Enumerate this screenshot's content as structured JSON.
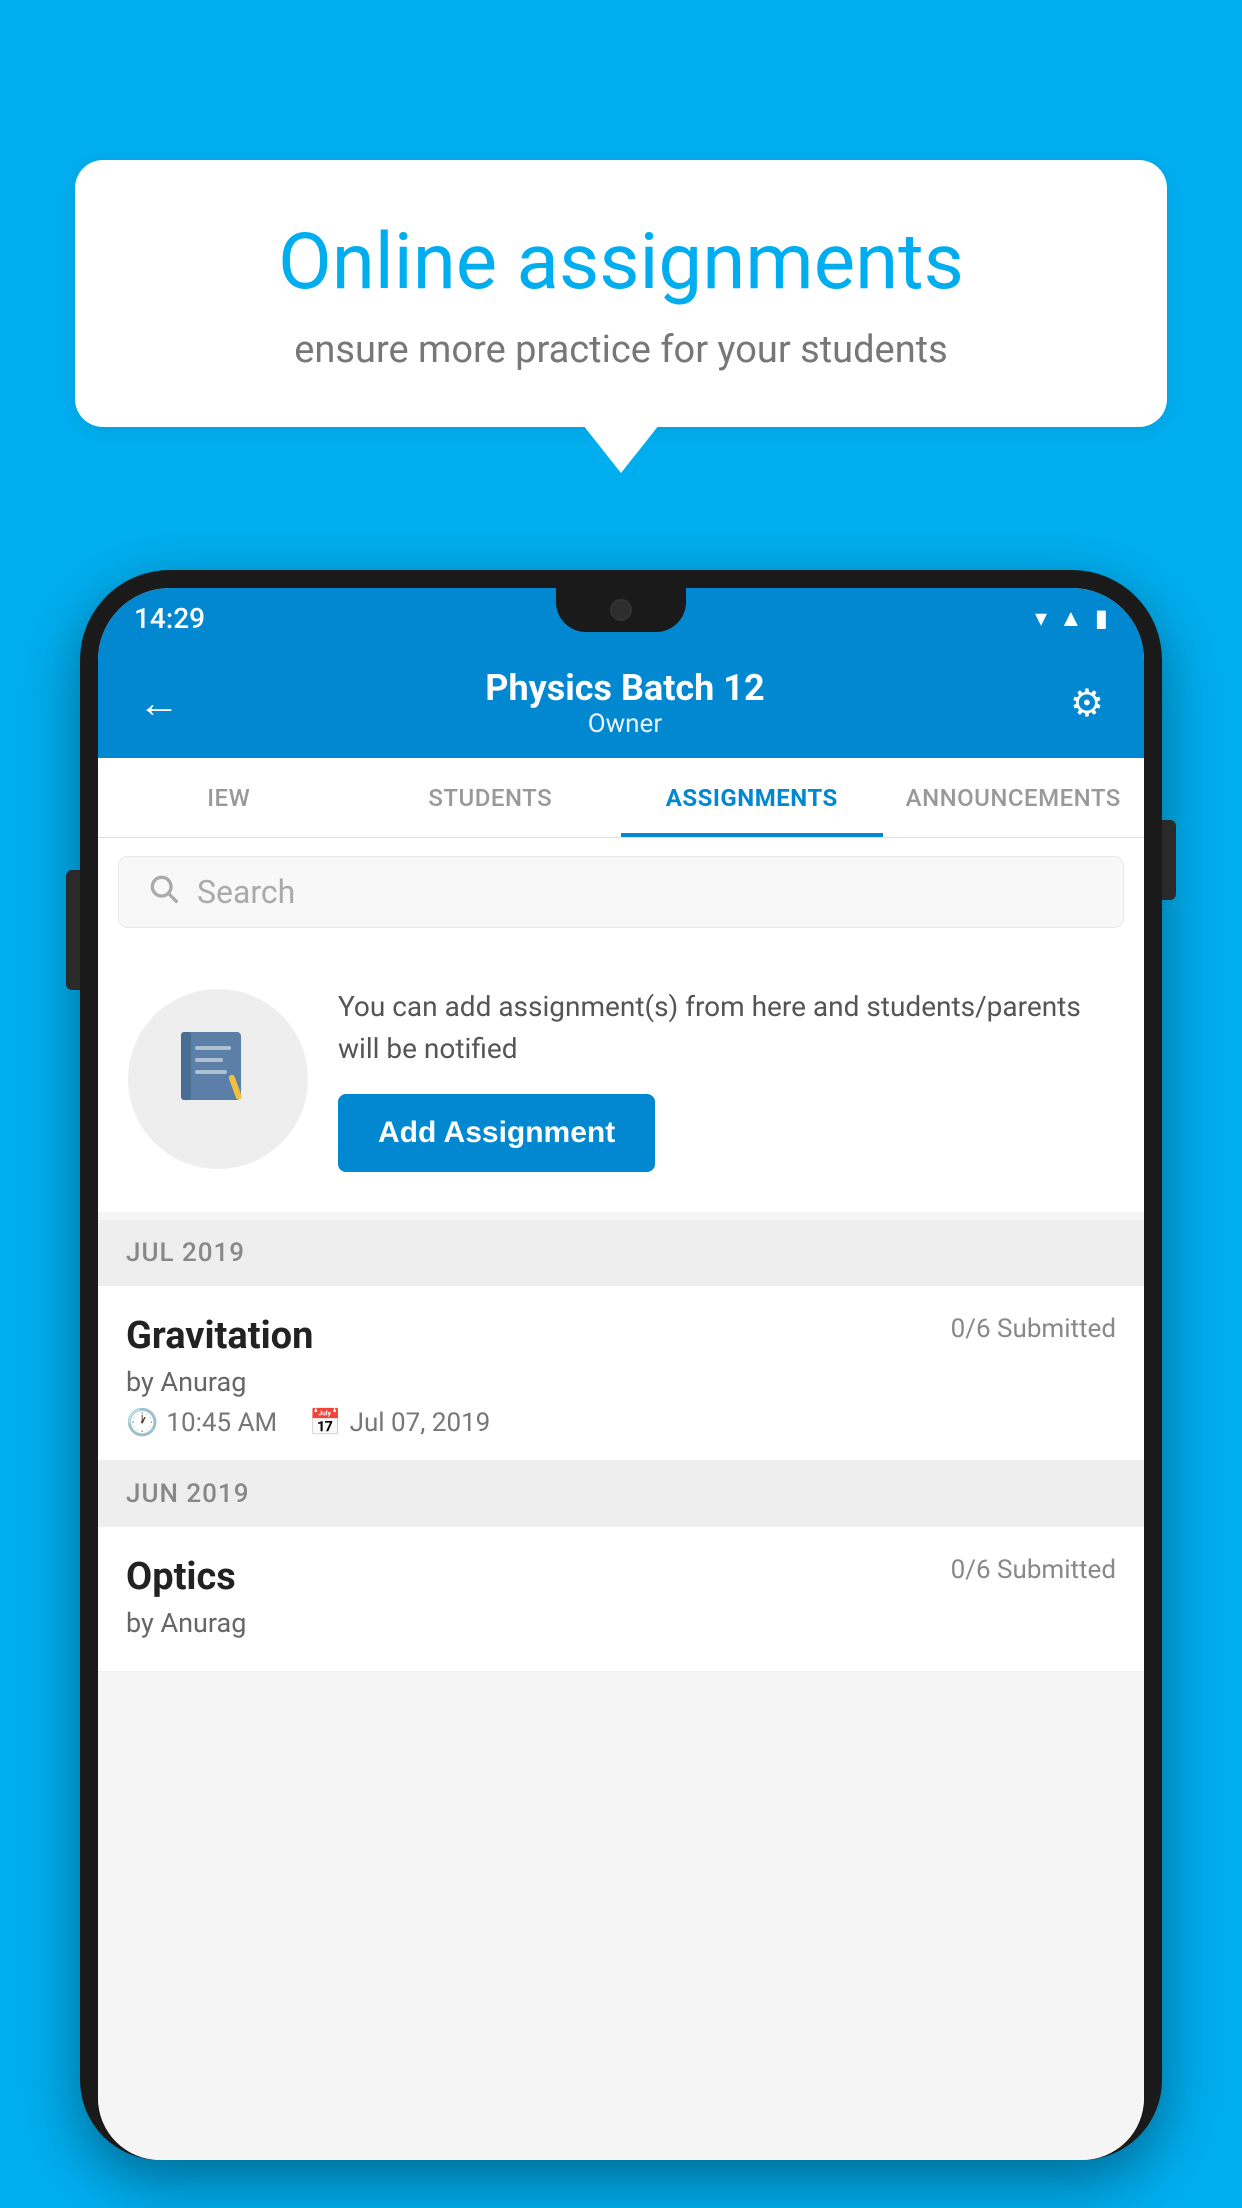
{
  "background_color": "#00AEEF",
  "bubble": {
    "title": "Online assignments",
    "subtitle": "ensure more practice for your students"
  },
  "status_bar": {
    "time": "14:29"
  },
  "app_bar": {
    "title": "Physics Batch 12",
    "subtitle": "Owner",
    "back_icon": "←",
    "settings_icon": "⚙"
  },
  "tabs": [
    {
      "id": "view",
      "label": "IEW",
      "active": false
    },
    {
      "id": "students",
      "label": "STUDENTS",
      "active": false
    },
    {
      "id": "assignments",
      "label": "ASSIGNMENTS",
      "active": true
    },
    {
      "id": "announcements",
      "label": "ANNOUNCEMENTS",
      "active": false
    }
  ],
  "search": {
    "placeholder": "Search"
  },
  "promo": {
    "text": "You can add assignment(s) from here and students/parents will be notified",
    "add_button_label": "Add Assignment"
  },
  "sections": [
    {
      "header": "JUL 2019",
      "assignments": [
        {
          "name": "Gravitation",
          "submitted": "0/6 Submitted",
          "by": "by Anurag",
          "time": "10:45 AM",
          "date": "Jul 07, 2019"
        }
      ]
    },
    {
      "header": "JUN 2019",
      "assignments": [
        {
          "name": "Optics",
          "submitted": "0/6 Submitted",
          "by": "by Anurag",
          "time": "",
          "date": ""
        }
      ]
    }
  ]
}
